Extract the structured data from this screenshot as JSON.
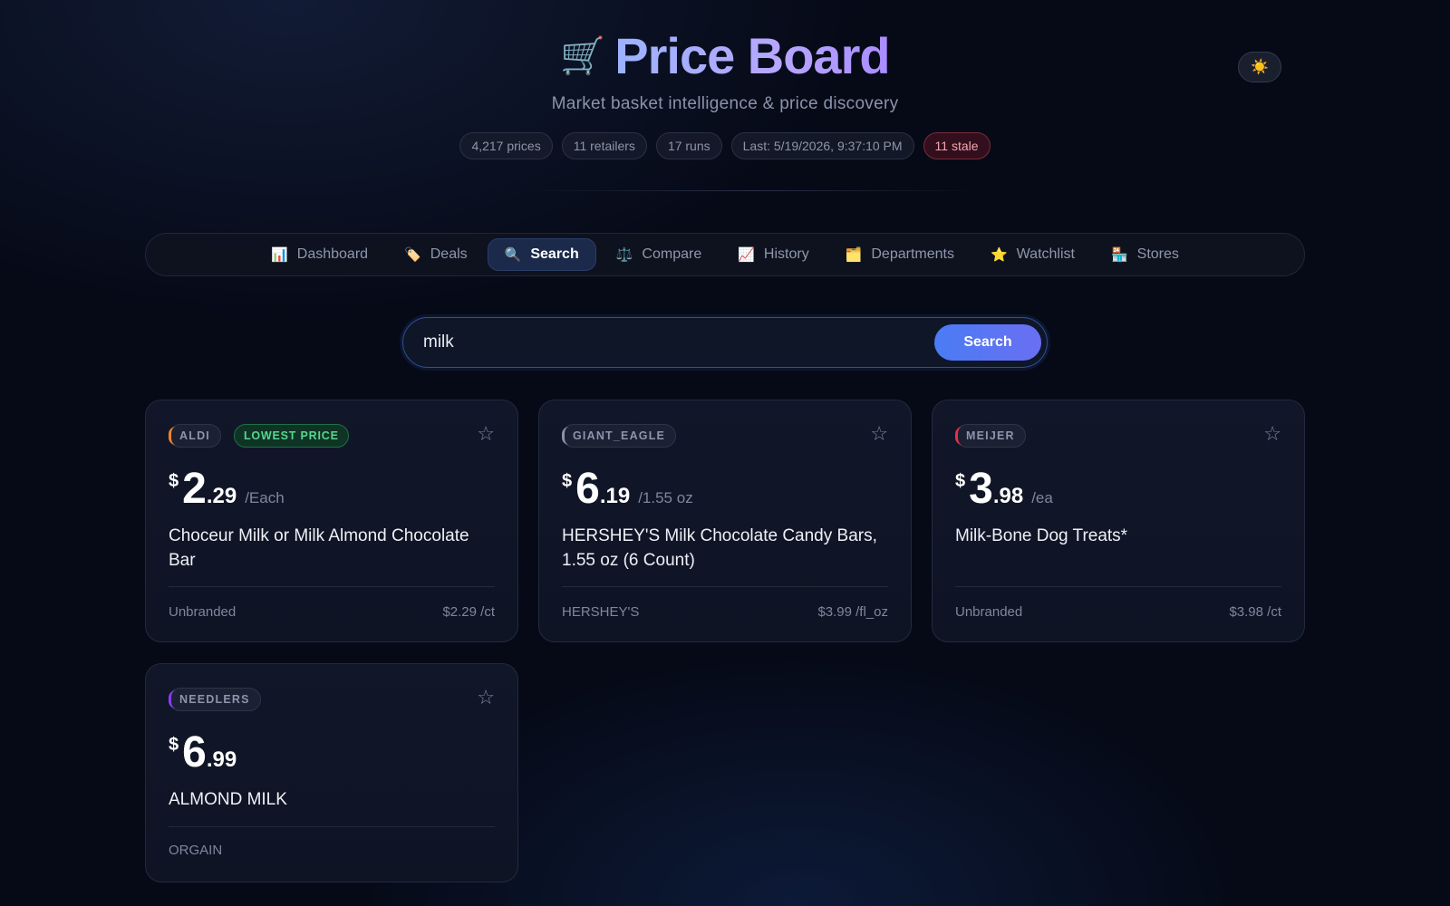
{
  "header": {
    "cart_icon": "🛒",
    "title": "Price Board",
    "subtitle": "Market basket intelligence & price discovery",
    "theme_icon": "☀️",
    "stats": [
      "4,217 prices",
      "11 retailers",
      "17 runs",
      "Last: 5/19/2026, 9:37:10 PM",
      "11 stale"
    ]
  },
  "nav": [
    {
      "icon": "📊",
      "label": "Dashboard"
    },
    {
      "icon": "🏷️",
      "label": "Deals"
    },
    {
      "icon": "🔍",
      "label": "Search",
      "active": true
    },
    {
      "icon": "⚖️",
      "label": "Compare"
    },
    {
      "icon": "📈",
      "label": "History"
    },
    {
      "icon": "🗂️",
      "label": "Departments"
    },
    {
      "icon": "⭐",
      "label": "Watchlist"
    },
    {
      "icon": "🏪",
      "label": "Stores"
    }
  ],
  "search": {
    "value": "milk",
    "button_label": "Search"
  },
  "colors": {
    "aldi": "#f0852b",
    "giant_eagle": "#8a93a8",
    "meijer": "#e2304a",
    "needlers": "#8b3cf0"
  },
  "results": [
    {
      "store": "ALDI",
      "deal": "LOWEST PRICE",
      "currency": "$",
      "whole": "2",
      "cents": ".29",
      "unit": "/Each",
      "name": "Choceur Milk or Milk Almond Chocolate Bar",
      "brand": "Unbranded",
      "unit_price": "$2.29 /ct"
    },
    {
      "store": "GIANT_EAGLE",
      "currency": "$",
      "whole": "6",
      "cents": ".19",
      "unit": "/1.55 oz",
      "name": "HERSHEY'S Milk Chocolate Candy Bars, 1.55 oz (6 Count)",
      "brand": "HERSHEY'S",
      "unit_price": "$3.99 /fl_oz"
    },
    {
      "store": "MEIJER",
      "currency": "$",
      "whole": "3",
      "cents": ".98",
      "unit": "/ea",
      "name": "Milk-Bone Dog Treats*",
      "brand": "Unbranded",
      "unit_price": "$3.98 /ct"
    },
    {
      "store": "NEEDLERS",
      "currency": "$",
      "whole": "6",
      "cents": ".99",
      "unit": "",
      "name": "ALMOND MILK",
      "brand": "ORGAIN",
      "unit_price": ""
    }
  ]
}
